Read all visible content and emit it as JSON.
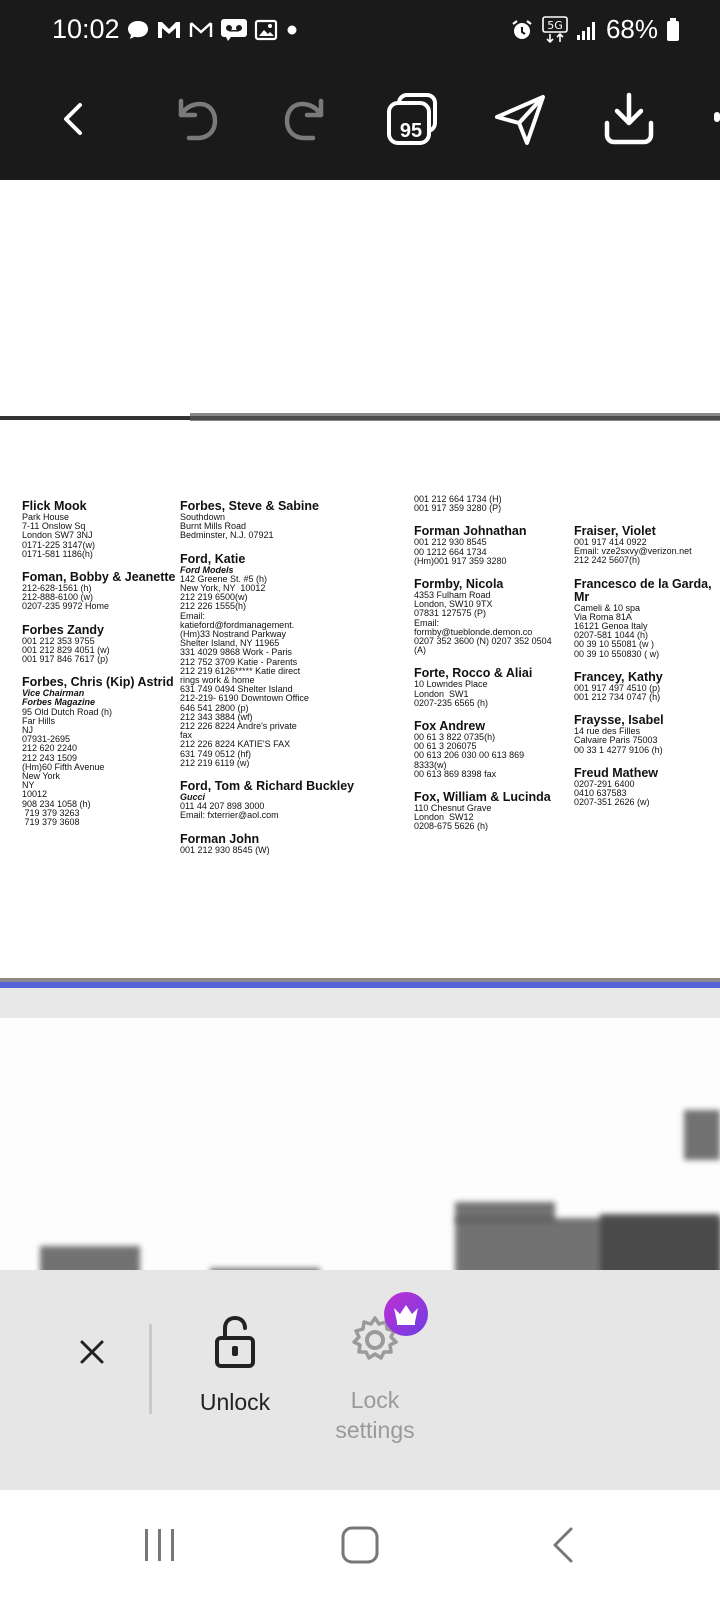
{
  "status_bar": {
    "time": "10:02",
    "battery": "68%",
    "network": "5G"
  },
  "toolbar": {
    "page_count_badge": "95"
  },
  "document": {
    "columns": [
      [
        {
          "name": "Flick Mook",
          "lines": [
            "Park House",
            "7-11 Onslow Sq",
            "London SW7 3NJ",
            "0171-225 3147(w)",
            "0171-581 1186(h)"
          ]
        },
        {
          "name": "Foman, Bobby & Jeanette",
          "lines": [
            "212-628-1561 (h)",
            "212-888-6100 (w)",
            "0207-235 9972 Home"
          ]
        },
        {
          "name": "Forbes Zandy",
          "lines": [
            "001 212 353 9755",
            "001 212 829 4051 (w)",
            "001 917 846 7617 (p)"
          ]
        },
        {
          "name": "Forbes, Chris (Kip) Astrid",
          "lines": [
            "Vice Chairman",
            "Forbes Magazine",
            "95 Old Dutch Road (h)",
            "Far Hills",
            "NJ",
            "07931-2695",
            "212 620 2240",
            "212 243 1509",
            "(Hm)60 Fifth Avenue",
            "New York",
            "NY",
            "10012",
            "908 234 1058 (h)",
            " 719 379 3263",
            " 719 379 3608"
          ],
          "italic": [
            0,
            1
          ]
        }
      ],
      [
        {
          "name": "Forbes, Steve & Sabine",
          "lines": [
            "Southdown",
            "Burnt Mills Road",
            "Bedminster, N.J. 07921"
          ]
        },
        {
          "name": "Ford, Katie",
          "lines": [
            "Ford Models",
            "142 Greene St. #5 (h)",
            "New York, NY  10012",
            "212 219 6500(w)",
            "212 226 1555(h)",
            "Email:",
            "katieford@fordmanagement.",
            "(Hm)33 Nostrand Parkway",
            "Shelter Island, NY 11965",
            "331 4029 9868 Work - Paris",
            "212 752 3709 Katie - Parents",
            "212 219 6126***** Katie direct",
            "rings work & home",
            "631 749 0494 Shelter Island",
            "212-219- 6190 Downtown Office",
            "646 541 2800 (p)",
            "212 343 3884 (wf)",
            "212 226 8224 Andre's private",
            "fax",
            "212 226 8224 KATIE'S FAX",
            "631 749 0512 (hf)",
            "212 219 6119 (w)"
          ],
          "italic": [
            0
          ]
        },
        {
          "name": "Ford, Tom & Richard Buckley",
          "lines": [
            "Gucci",
            "011 44 207 898 3000",
            "Email: fxterrier@aol.com"
          ],
          "italic": [
            0
          ]
        },
        {
          "name": "Forman John",
          "lines": [
            "001 212 930 8545 (W)"
          ]
        }
      ],
      [
        {
          "name": "",
          "lines": [
            "001 212 664 1734 (H)",
            "001 917 359 3280 (P)"
          ]
        },
        {
          "name": "Forman Johnathan",
          "lines": [
            "001 212 930 8545",
            "00 1212 664 1734",
            "(Hm)001 917 359 3280"
          ]
        },
        {
          "name": "Formby, Nicola",
          "lines": [
            "4353 Fulham Road",
            "London, SW10 9TX",
            "07831 127575 (P)",
            "Email:",
            "formby@tueblonde.demon.co",
            "0207 352 3600 (N) 0207 352 0504",
            "(A)"
          ]
        },
        {
          "name": "Forte, Rocco & Aliai",
          "lines": [
            "10 Lowndes Place",
            "London  SW1",
            "0207-235 6565 (h)"
          ]
        },
        {
          "name": "Fox Andrew",
          "lines": [
            "00 61 3 822 0735(h)",
            "00 61 3 206075",
            "00 613 206 030 00 613 869",
            "8333(w)",
            "00 613 869 8398 fax"
          ]
        },
        {
          "name": "Fox, William & Lucinda",
          "lines": [
            "110 Chesnut Grave",
            "London  SW12",
            "0208-675 5626 (h)"
          ]
        }
      ],
      [
        {
          "name": "Fraiser, Violet",
          "lines": [
            "001 917 414 0922",
            "Email: vze2sxvy@verizon.net",
            "212 242 5607(h)"
          ]
        },
        {
          "name": "Francesco de la Garda, Mr",
          "lines": [
            "Cameli & 10 spa",
            "Via Roma 81A",
            "16121 Genoa Italy",
            "0207-581 1044 (h)",
            "00 39 10 55081 (w )",
            "00 39 10 550830 ( w)"
          ]
        },
        {
          "name": "Francey, Kathy",
          "lines": [
            "001 917 497 4510 (p)",
            "001 212 734 0747 (h)"
          ]
        },
        {
          "name": "Fraysse, Isabel",
          "lines": [
            "14 rue des Filles",
            "Calvaire Paris 75003",
            "00 33 1 4277 9106 (h)"
          ]
        },
        {
          "name": "Freud Mathew",
          "lines": [
            "0207-291 6400",
            "0410 637583",
            "0207-351 2626 (w)"
          ]
        }
      ]
    ]
  },
  "lock_panel": {
    "close_symbol": "×",
    "unlock_label": "Unlock",
    "lock_settings_label_1": "Lock",
    "lock_settings_label_2": "settings"
  }
}
